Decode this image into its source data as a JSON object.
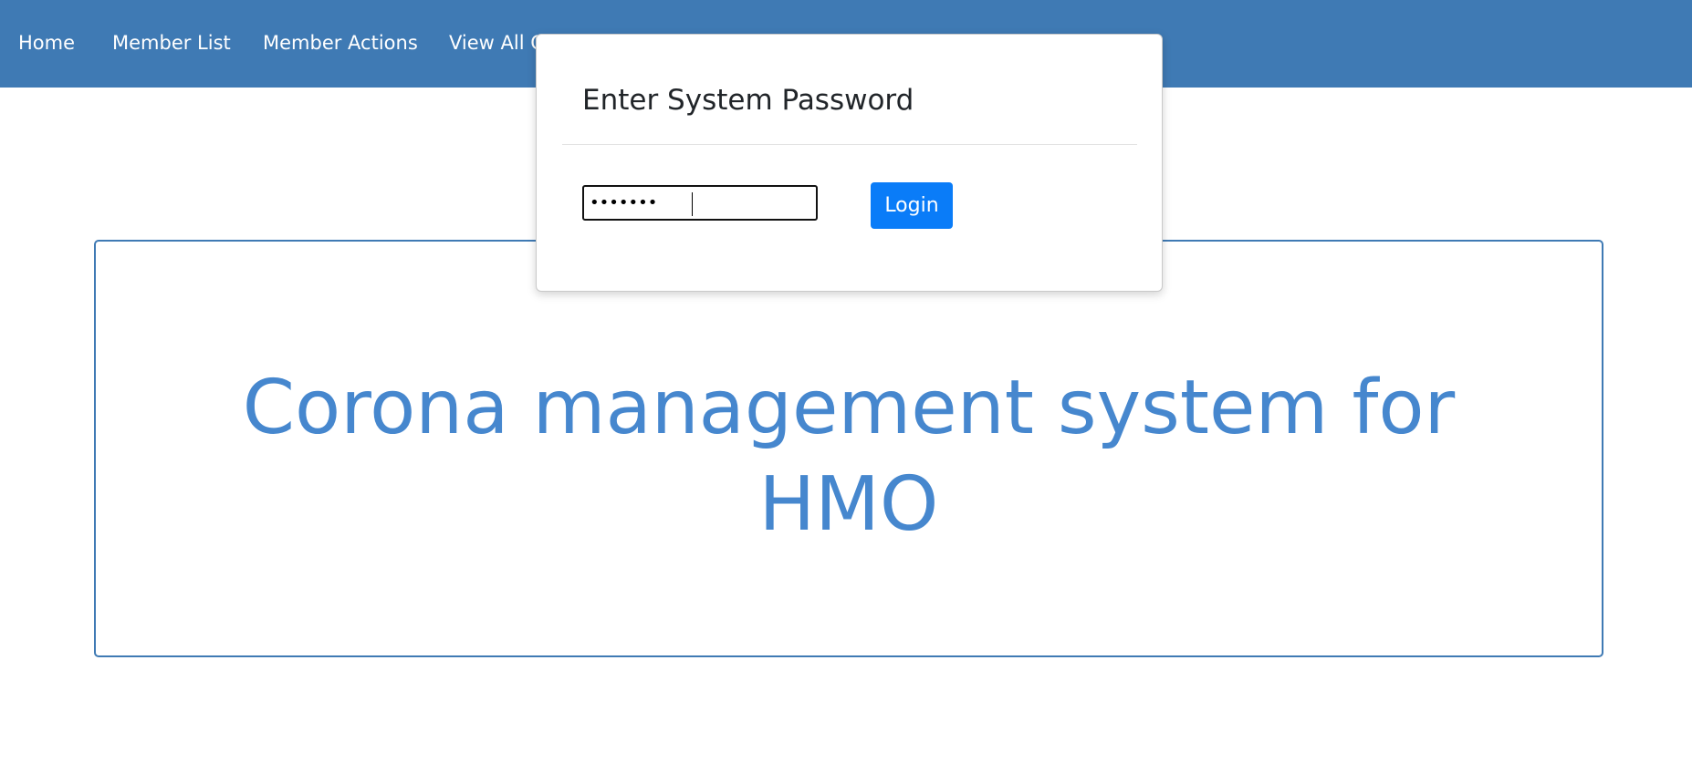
{
  "navbar": {
    "items": [
      {
        "label": "Home"
      },
      {
        "label": "Member List"
      },
      {
        "label": "Member Actions"
      },
      {
        "label": "View All C"
      }
    ],
    "color": "#3f7ab4"
  },
  "hero": {
    "title_line1": "Corona management system for",
    "title_line2": "HMO",
    "title_color": "#4687ce"
  },
  "modal": {
    "title": "Enter System Password",
    "password_value": "•••••••",
    "login_label": "Login",
    "button_color": "#0a7cf8"
  }
}
